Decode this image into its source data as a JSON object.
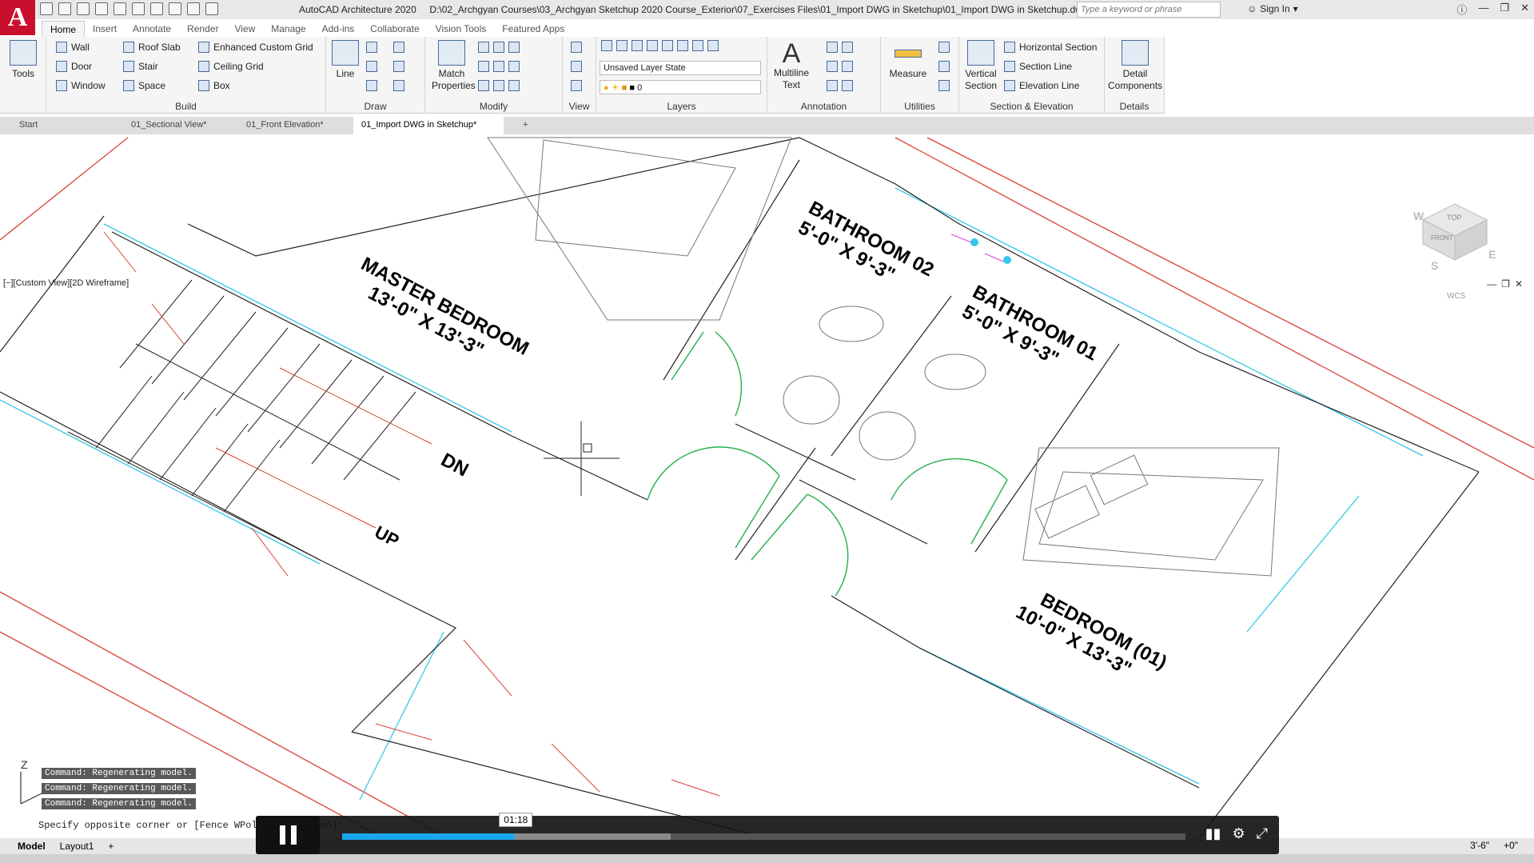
{
  "app": {
    "logo_letter": "A",
    "title": "AutoCAD Architecture 2020",
    "file_path": "D:\\02_Archgyan Courses\\03_Archgyan Sketchup 2020 Course_Exterior\\07_Exercises Files\\01_Import DWG in Sketchup\\01_Import DWG in Sketchup.dwg",
    "search_placeholder": "Type a keyword or phrase",
    "sign_in": "Sign In"
  },
  "ribbon_tabs": [
    "Home",
    "Insert",
    "Annotate",
    "Render",
    "View",
    "Manage",
    "Add-ins",
    "Collaborate",
    "Vision Tools",
    "Featured Apps"
  ],
  "ribbon": {
    "tools_label": "Tools",
    "build": {
      "title": "Build",
      "items": [
        "Wall",
        "Door",
        "Window",
        "Roof Slab",
        "Stair",
        "Space",
        "Enhanced Custom Grid",
        "Ceiling Grid",
        "Box"
      ]
    },
    "draw": {
      "title": "Draw",
      "line_label": "Line"
    },
    "modify": {
      "title": "Modify",
      "match_label": "Match Properties"
    },
    "view": {
      "title": "View"
    },
    "layers": {
      "title": "Layers",
      "layer_state": "Unsaved Layer State",
      "current_layer": "0"
    },
    "annotation": {
      "title": "Annotation",
      "multiline_label": "Multiline Text"
    },
    "utilities": {
      "title": "Utilities",
      "measure_label": "Measure"
    },
    "section": {
      "title": "Section & Elevation",
      "vertical_label": "Vertical Section",
      "items": [
        "Horizontal Section",
        "Section Line",
        "Elevation Line"
      ]
    },
    "details": {
      "title": "Details",
      "detail_label": "Detail Components"
    }
  },
  "file_tabs": [
    "Start",
    "01_Sectional View*",
    "01_Front Elevation*",
    "01_Import DWG in Sketchup*"
  ],
  "viewport": {
    "view_label": "[−][Custom View][2D Wireframe]",
    "viewcube": {
      "top": "TOP",
      "front": "FRONT",
      "compass": [
        "W",
        "S",
        "E"
      ],
      "wcs": "WCS"
    },
    "rooms": [
      {
        "name": "MASTER BEDROOM",
        "size": "13'-0\" X 13'-3\""
      },
      {
        "name": "BATHROOM 02",
        "size": "5'-0\" X 9'-3\""
      },
      {
        "name": "BATHROOM 01",
        "size": "5'-0\" X 9'-3\""
      },
      {
        "name": "BEDROOM (01)",
        "size": "10'-0\" X 13'-3\""
      }
    ],
    "stair_labels": [
      "DN",
      "UP"
    ]
  },
  "command_history": [
    "Command:  Regenerating model.",
    "Command:  Regenerating model.",
    "Command:  Regenerating model."
  ],
  "command_prompt": "Specify opposite corner or [Fence WPolygon CPolygon]:",
  "layout_tabs": [
    "Model",
    "Layout1"
  ],
  "status": {
    "scale": "3'-6\"",
    "offset": "+0\""
  },
  "player": {
    "time": "01:18",
    "progress": 0.205,
    "buffered": 0.39
  },
  "colors": {
    "accent_red": "#c8102e",
    "progress_blue": "#1aa7ec",
    "door_green": "#22b14c",
    "cyan": "#36c8e8"
  }
}
